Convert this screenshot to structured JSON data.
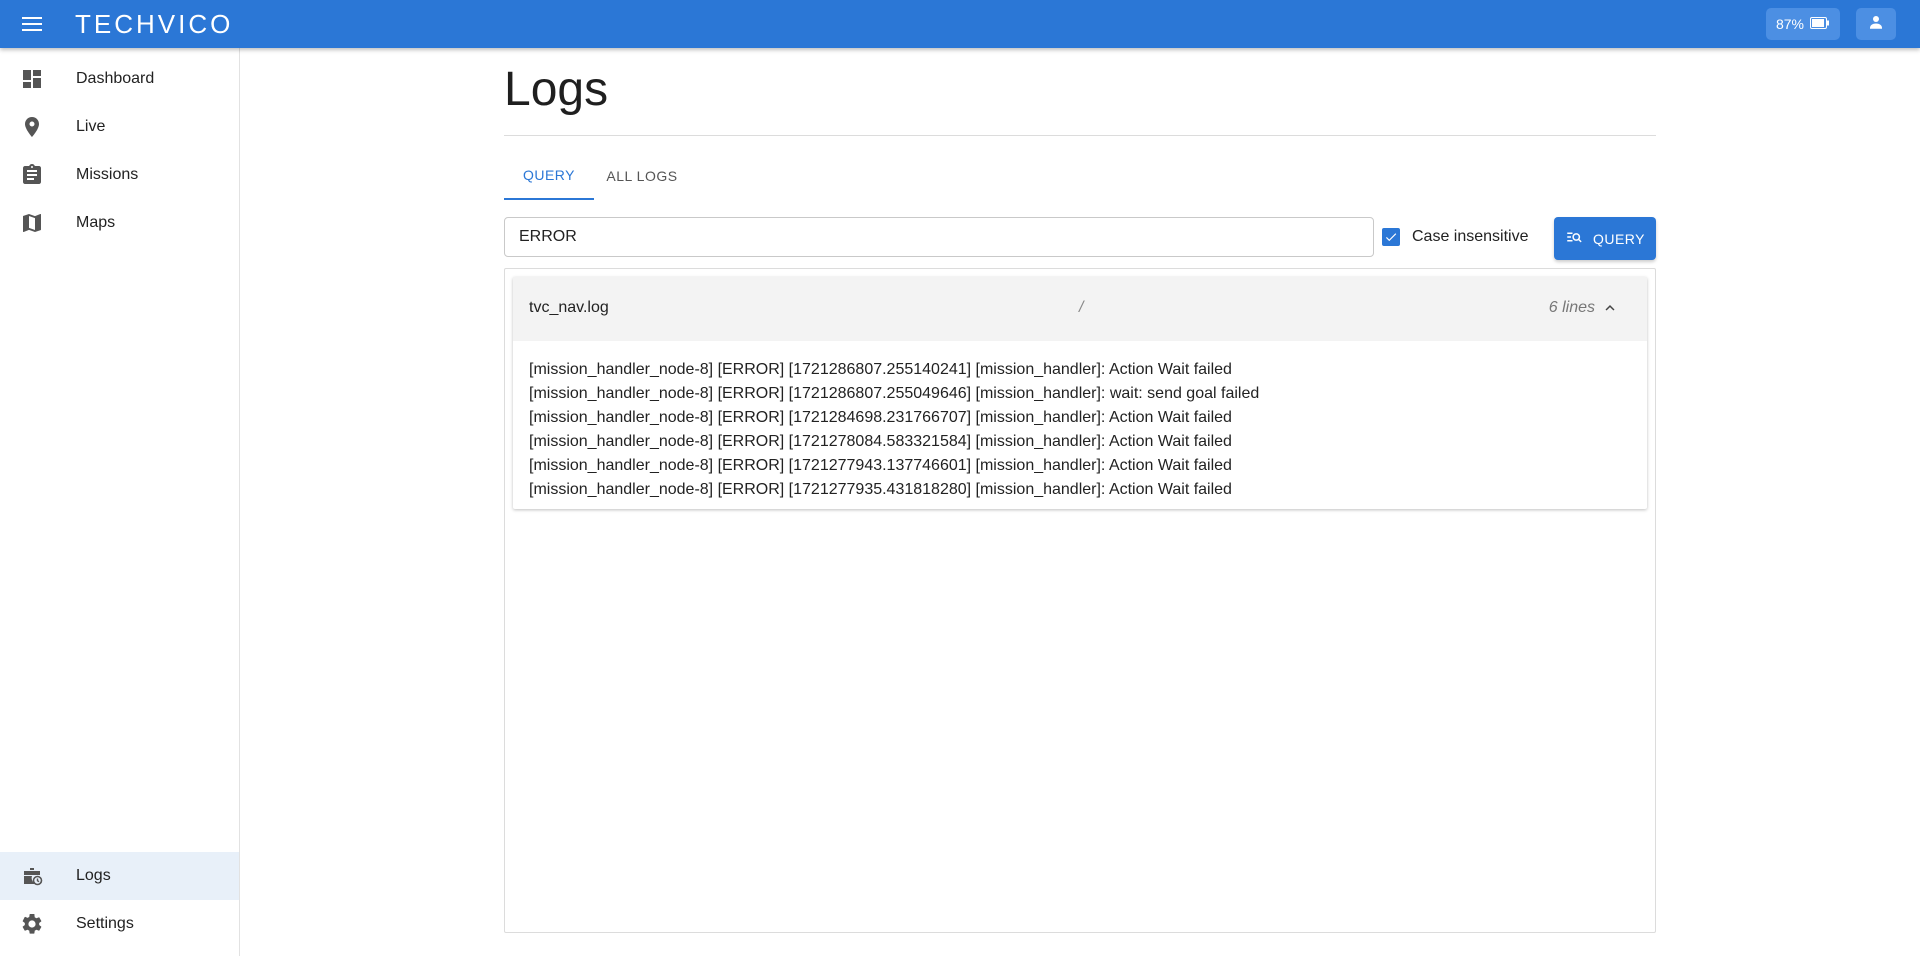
{
  "header": {
    "logo_text": "TECHVICO",
    "battery_label": "87%",
    "colors": {
      "appbar": "#2b77d6",
      "accent": "#2b77d6"
    }
  },
  "sidebar": {
    "items": [
      {
        "label": "Dashboard",
        "icon": "dashboard-icon"
      },
      {
        "label": "Live",
        "icon": "location-pin-icon"
      },
      {
        "label": "Missions",
        "icon": "clipboard-icon"
      },
      {
        "label": "Maps",
        "icon": "map-icon"
      }
    ],
    "bottom_items": [
      {
        "label": "Logs",
        "icon": "logs-briefcase-icon",
        "active": true
      },
      {
        "label": "Settings",
        "icon": "gear-icon"
      }
    ]
  },
  "main": {
    "title": "Logs",
    "tabs": [
      {
        "label": "QUERY",
        "active": true
      },
      {
        "label": "ALL LOGS",
        "active": false
      }
    ],
    "search": {
      "value": "ERROR"
    },
    "case_insensitive": {
      "label": "Case insensitive",
      "checked": true
    },
    "query_button": {
      "label": "QUERY"
    },
    "results": [
      {
        "file": "tvc_nav.log",
        "separator": "/",
        "count_label": "6 lines",
        "expanded": true,
        "lines": [
          "[mission_handler_node-8] [ERROR] [1721286807.255140241] [mission_handler]: Action Wait failed",
          "[mission_handler_node-8] [ERROR] [1721286807.255049646] [mission_handler]: wait: send goal failed",
          "[mission_handler_node-8] [ERROR] [1721284698.231766707] [mission_handler]: Action Wait failed",
          "[mission_handler_node-8] [ERROR] [1721278084.583321584] [mission_handler]: Action Wait failed",
          "[mission_handler_node-8] [ERROR] [1721277943.137746601] [mission_handler]: Action Wait failed",
          "[mission_handler_node-8] [ERROR] [1721277935.431818280] [mission_handler]: Action Wait failed"
        ]
      }
    ]
  }
}
